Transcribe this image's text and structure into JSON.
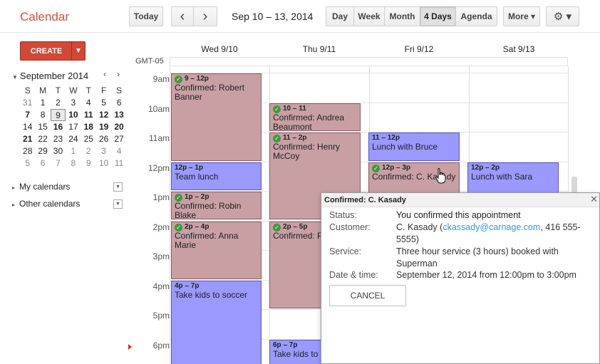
{
  "app": {
    "title": "Calendar"
  },
  "toolbar": {
    "today_label": "Today",
    "prev_icon": "‹",
    "next_icon": "›",
    "date_range": "Sep 10 – 13, 2014",
    "views": [
      "Day",
      "Week",
      "Month",
      "4 Days",
      "Agenda"
    ],
    "selected_view": "4 Days",
    "more_label": "More ▾",
    "settings_icon": "⚙ ▾"
  },
  "create": {
    "label": "CREATE",
    "arrow": "▼"
  },
  "mini_calendar": {
    "title": "September 2014",
    "prev": "‹",
    "next": "›",
    "weekdays": [
      "S",
      "M",
      "T",
      "W",
      "T",
      "F",
      "S"
    ],
    "weeks": [
      [
        "31",
        "1",
        "2",
        "3",
        "4",
        "5",
        "6"
      ],
      [
        "7",
        "8",
        "9",
        "10",
        "11",
        "12",
        "13"
      ],
      [
        "14",
        "15",
        "16",
        "17",
        "18",
        "19",
        "20"
      ],
      [
        "21",
        "22",
        "23",
        "24",
        "25",
        "26",
        "27"
      ],
      [
        "28",
        "29",
        "30",
        "1",
        "2",
        "3",
        "4"
      ],
      [
        "5",
        "6",
        "7",
        "8",
        "9",
        "10",
        "11"
      ]
    ]
  },
  "sidebar": {
    "my_calendars": "My calendars",
    "other_calendars": "Other calendars",
    "collapse_icon": "▸",
    "drop_icon": "▼"
  },
  "grid": {
    "timezone": "GMT-05",
    "days": [
      "Wed 9/10",
      "Thu 9/11",
      "Fri 9/12",
      "Sat 9/13"
    ],
    "hours": [
      "9am",
      "10am",
      "11am",
      "12pm",
      "1pm",
      "2pm",
      "3pm",
      "4pm",
      "5pm",
      "6pm"
    ]
  },
  "events": {
    "e1": {
      "time": "9 – 12p",
      "name": "Confirmed: Robert Banner"
    },
    "e2": {
      "time": "12p – 1p",
      "name": "Team lunch"
    },
    "e3": {
      "time": "1p – 2p",
      "name": "Confirmed: Robin Blake"
    },
    "e4": {
      "time": "2p – 4p",
      "name": "Confirmed: Anna Marie"
    },
    "e5": {
      "time": "4p – 7p",
      "name": "Take kids to soccer"
    },
    "e6": {
      "time": "10 – 11",
      "name": "Confirmed: Andrea Beaumont"
    },
    "e7": {
      "time": "11 – 2p",
      "name": "Confirmed: Henry McCoy"
    },
    "e8": {
      "time": "2p – 5p",
      "name": "Confirmed: P White"
    },
    "e9": {
      "time": "6p – 7p",
      "name": "Take kids to"
    },
    "e10": {
      "time": "11 – 12p",
      "name": "Lunch with Bruce"
    },
    "e11": {
      "time": "12p – 3p",
      "name": "Confirmed: C. Kasady"
    },
    "e12": {
      "time": "12p – 2p",
      "name": "Lunch with Sara"
    },
    "check_icon": "✓"
  },
  "popup": {
    "title": "Confirmed: C. Kasady",
    "close_icon": "✕",
    "status_label": "Status:",
    "status_value": "You confirmed this appointment",
    "customer_label": "Customer:",
    "customer_name": "C. Kasady (",
    "customer_email": "ckassady@carnage.com",
    "customer_phone": ", 416 555-5555)",
    "service_label": "Service:",
    "service_value": "Three hour service (3 hours) booked with Superman",
    "datetime_label": "Date & time:",
    "datetime_value": "September 12, 2014 from 12:00pm to 3:00pm",
    "cancel_label": "CANCEL"
  }
}
